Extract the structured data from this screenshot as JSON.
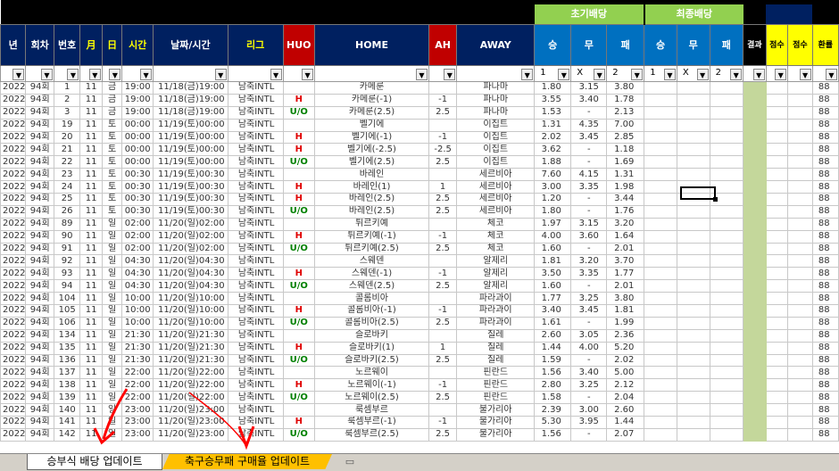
{
  "groups": {
    "early": "초기배당",
    "final": "최종배당"
  },
  "headers": [
    "년",
    "회차",
    "번호",
    "月",
    "日",
    "시간",
    "날짜/시간",
    "리그",
    "HUO",
    "HOME",
    "AH",
    "AWAY",
    "승",
    "무",
    "패",
    "승",
    "무",
    "패",
    "결과",
    "점수",
    "점수",
    "환률"
  ],
  "filters": {
    "early": [
      "1",
      "X",
      "2"
    ],
    "final": [
      "1",
      "X",
      "2"
    ]
  },
  "rows": [
    [
      "2022",
      "94회",
      "1",
      "11",
      "금",
      "19:00",
      "11/18(금)19:00",
      "남축INTL",
      "",
      "카메룬",
      "",
      "파나마",
      "1.80",
      "3.15",
      "3.80",
      "88"
    ],
    [
      "2022",
      "94회",
      "2",
      "11",
      "금",
      "19:00",
      "11/18(금)19:00",
      "남축INTL",
      "H",
      "카메룬(-1)",
      "-1",
      "파나마",
      "3.55",
      "3.40",
      "1.78",
      "88"
    ],
    [
      "2022",
      "94회",
      "3",
      "11",
      "금",
      "19:00",
      "11/18(금)19:00",
      "남축INTL",
      "U/O",
      "카메룬(2.5)",
      "2.5",
      "파나마",
      "1.53",
      "-",
      "2.13",
      "88"
    ],
    [
      "2022",
      "94회",
      "19",
      "11",
      "토",
      "00:00",
      "11/19(토)00:00",
      "남축INTL",
      "",
      "벨기에",
      "",
      "이집트",
      "1.31",
      "4.35",
      "7.00",
      "88"
    ],
    [
      "2022",
      "94회",
      "20",
      "11",
      "토",
      "00:00",
      "11/19(토)00:00",
      "남축INTL",
      "H",
      "벨기에(-1)",
      "-1",
      "이집트",
      "2.02",
      "3.45",
      "2.85",
      "88"
    ],
    [
      "2022",
      "94회",
      "21",
      "11",
      "토",
      "00:00",
      "11/19(토)00:00",
      "남축INTL",
      "H",
      "벨기에(-2.5)",
      "-2.5",
      "이집트",
      "3.62",
      "-",
      "1.18",
      "88"
    ],
    [
      "2022",
      "94회",
      "22",
      "11",
      "토",
      "00:00",
      "11/19(토)00:00",
      "남축INTL",
      "U/O",
      "벨기에(2.5)",
      "2.5",
      "이집트",
      "1.88",
      "-",
      "1.69",
      "88"
    ],
    [
      "2022",
      "94회",
      "23",
      "11",
      "토",
      "00:30",
      "11/19(토)00:30",
      "남축INTL",
      "",
      "바레인",
      "",
      "세르비아",
      "7.60",
      "4.15",
      "1.31",
      "88"
    ],
    [
      "2022",
      "94회",
      "24",
      "11",
      "토",
      "00:30",
      "11/19(토)00:30",
      "남축INTL",
      "H",
      "바레인(1)",
      "1",
      "세르비아",
      "3.00",
      "3.35",
      "1.98",
      "88"
    ],
    [
      "2022",
      "94회",
      "25",
      "11",
      "토",
      "00:30",
      "11/19(토)00:30",
      "남축INTL",
      "H",
      "바레인(2.5)",
      "2.5",
      "세르비아",
      "1.20",
      "-",
      "3.44",
      "88"
    ],
    [
      "2022",
      "94회",
      "26",
      "11",
      "토",
      "00:30",
      "11/19(토)00:30",
      "남축INTL",
      "U/O",
      "바레인(2.5)",
      "2.5",
      "세르비아",
      "1.80",
      "-",
      "1.76",
      "88"
    ],
    [
      "2022",
      "94회",
      "89",
      "11",
      "일",
      "02:00",
      "11/20(일)02:00",
      "남축INTL",
      "",
      "튀르키예",
      "",
      "체코",
      "1.97",
      "3.15",
      "3.20",
      "88"
    ],
    [
      "2022",
      "94회",
      "90",
      "11",
      "일",
      "02:00",
      "11/20(일)02:00",
      "남축INTL",
      "H",
      "튀르키예(-1)",
      "-1",
      "체코",
      "4.00",
      "3.60",
      "1.64",
      "88"
    ],
    [
      "2022",
      "94회",
      "91",
      "11",
      "일",
      "02:00",
      "11/20(일)02:00",
      "남축INTL",
      "U/O",
      "튀르키예(2.5)",
      "2.5",
      "체코",
      "1.60",
      "-",
      "2.01",
      "88"
    ],
    [
      "2022",
      "94회",
      "92",
      "11",
      "일",
      "04:30",
      "11/20(일)04:30",
      "남축INTL",
      "",
      "스웨덴",
      "",
      "알제리",
      "1.81",
      "3.20",
      "3.70",
      "88"
    ],
    [
      "2022",
      "94회",
      "93",
      "11",
      "일",
      "04:30",
      "11/20(일)04:30",
      "남축INTL",
      "H",
      "스웨덴(-1)",
      "-1",
      "알제리",
      "3.50",
      "3.35",
      "1.77",
      "88"
    ],
    [
      "2022",
      "94회",
      "94",
      "11",
      "일",
      "04:30",
      "11/20(일)04:30",
      "남축INTL",
      "U/O",
      "스웨덴(2.5)",
      "2.5",
      "알제리",
      "1.60",
      "-",
      "2.01",
      "88"
    ],
    [
      "2022",
      "94회",
      "104",
      "11",
      "일",
      "10:00",
      "11/20(일)10:00",
      "남축INTL",
      "",
      "콜롬비아",
      "",
      "파라과이",
      "1.77",
      "3.25",
      "3.80",
      "88"
    ],
    [
      "2022",
      "94회",
      "105",
      "11",
      "일",
      "10:00",
      "11/20(일)10:00",
      "남축INTL",
      "H",
      "콜롬비아(-1)",
      "-1",
      "파라과이",
      "3.40",
      "3.45",
      "1.81",
      "88"
    ],
    [
      "2022",
      "94회",
      "106",
      "11",
      "일",
      "10:00",
      "11/20(일)10:00",
      "남축INTL",
      "U/O",
      "콜롬비아(2.5)",
      "2.5",
      "파라과이",
      "1.61",
      "-",
      "1.99",
      "88"
    ],
    [
      "2022",
      "94회",
      "134",
      "11",
      "일",
      "21:30",
      "11/20(일)21:30",
      "남축INTL",
      "",
      "슬로바키",
      "",
      "칠레",
      "2.60",
      "3.05",
      "2.36",
      "88"
    ],
    [
      "2022",
      "94회",
      "135",
      "11",
      "일",
      "21:30",
      "11/20(일)21:30",
      "남축INTL",
      "H",
      "슬로바키(1)",
      "1",
      "칠레",
      "1.44",
      "4.00",
      "5.20",
      "88"
    ],
    [
      "2022",
      "94회",
      "136",
      "11",
      "일",
      "21:30",
      "11/20(일)21:30",
      "남축INTL",
      "U/O",
      "슬로바키(2.5)",
      "2.5",
      "칠레",
      "1.59",
      "-",
      "2.02",
      "88"
    ],
    [
      "2022",
      "94회",
      "137",
      "11",
      "일",
      "22:00",
      "11/20(일)22:00",
      "남축INTL",
      "",
      "노르웨이",
      "",
      "핀란드",
      "1.56",
      "3.40",
      "5.00",
      "88"
    ],
    [
      "2022",
      "94회",
      "138",
      "11",
      "일",
      "22:00",
      "11/20(일)22:00",
      "남축INTL",
      "H",
      "노르웨이(-1)",
      "-1",
      "핀란드",
      "2.80",
      "3.25",
      "2.12",
      "88"
    ],
    [
      "2022",
      "94회",
      "139",
      "11",
      "일",
      "22:00",
      "11/20(일)22:00",
      "남축INTL",
      "U/O",
      "노르웨이(2.5)",
      "2.5",
      "핀란드",
      "1.58",
      "-",
      "2.04",
      "88"
    ],
    [
      "2022",
      "94회",
      "140",
      "11",
      "일",
      "23:00",
      "11/20(일)23:00",
      "남축INTL",
      "",
      "룩셈부르",
      "",
      "불가리아",
      "2.39",
      "3.00",
      "2.60",
      "88"
    ],
    [
      "2022",
      "94회",
      "141",
      "11",
      "일",
      "23:00",
      "11/20(일)23:00",
      "남축INTL",
      "H",
      "룩셈부르(-1)",
      "-1",
      "불가리아",
      "5.30",
      "3.95",
      "1.44",
      "88"
    ],
    [
      "2022",
      "94회",
      "142",
      "11",
      "일",
      "23:00",
      "11/20(일)23:00",
      "남축INTL",
      "U/O",
      "룩셈부르(2.5)",
      "2.5",
      "불가리아",
      "1.56",
      "-",
      "2.07",
      "88"
    ]
  ],
  "tabs": {
    "tab1": "승부식 배당 업데이트",
    "tab2": "축구승무패 구매율 업데이트",
    "tab3_icon": "new-sheet-icon"
  }
}
